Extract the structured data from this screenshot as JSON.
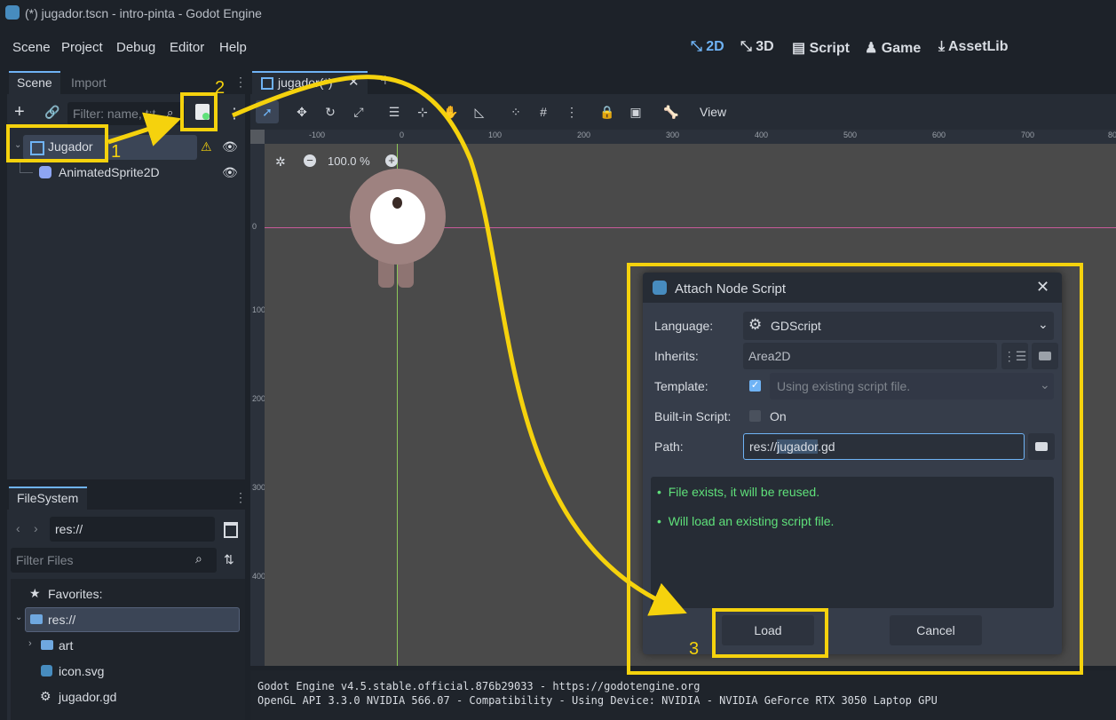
{
  "window": {
    "title": "(*) jugador.tscn - intro-pinta - Godot Engine"
  },
  "menu": [
    "Scene",
    "Project",
    "Debug",
    "Editor",
    "Help"
  ],
  "main_screens": [
    {
      "label": "2D",
      "icon": "2d-icon"
    },
    {
      "label": "3D",
      "icon": "3d-icon"
    },
    {
      "label": "Script",
      "icon": "script-icon"
    },
    {
      "label": "Game",
      "icon": "game-icon"
    },
    {
      "label": "AssetLib",
      "icon": "download-icon"
    }
  ],
  "scene_dock": {
    "tabs": [
      "Scene",
      "Import"
    ],
    "filter_placeholder": "Filter: name, t:t",
    "nodes": [
      {
        "name": "Jugador",
        "icon": "area2d-icon"
      },
      {
        "name": "AnimatedSprite2D",
        "icon": "animatedsprite-icon"
      }
    ]
  },
  "filesystem": {
    "tab": "FileSystem",
    "path": "res://",
    "filter_placeholder": "Filter Files",
    "favorites": "Favorites:",
    "items": [
      "res://",
      "art",
      "icon.svg",
      "jugador.gd"
    ]
  },
  "editor": {
    "tab": "jugador(*)",
    "toolbar_view": "View",
    "zoom": "100.0 %",
    "ruler_x": [
      "-100",
      "0",
      "100",
      "200",
      "300",
      "400",
      "500",
      "600",
      "700",
      "80"
    ],
    "ruler_y": [
      "0",
      "100",
      "200",
      "300",
      "400"
    ]
  },
  "dialog": {
    "title": "Attach Node Script",
    "language_label": "Language:",
    "language_value": "GDScript",
    "inherits_label": "Inherits:",
    "inherits_value": "Area2D",
    "template_label": "Template:",
    "template_value": "Using existing script file.",
    "builtin_label": "Built-in Script:",
    "builtin_value": "On",
    "path_label": "Path:",
    "path_prefix": "res://",
    "path_highlight": "jugador",
    "path_suffix": ".gd",
    "messages": [
      "File exists, it will be reused.",
      "Will load an existing script file."
    ],
    "load_button": "Load",
    "cancel_button": "Cancel"
  },
  "output": {
    "lines": [
      "Godot Engine v4.5.stable.official.876b29033 - https://godotengine.org",
      "OpenGL API 3.3.0 NVIDIA 566.07 - Compatibility - Using Device: NVIDIA - NVIDIA GeForce RTX 3050 Laptop GPU"
    ]
  },
  "annotations": {
    "step1": "1",
    "step2": "2",
    "step3": "3"
  },
  "colors": {
    "accent": "#6fb3f5",
    "annotation": "#f5d20d",
    "success_text": "#5fe07a",
    "warning": "#f5d20d"
  }
}
